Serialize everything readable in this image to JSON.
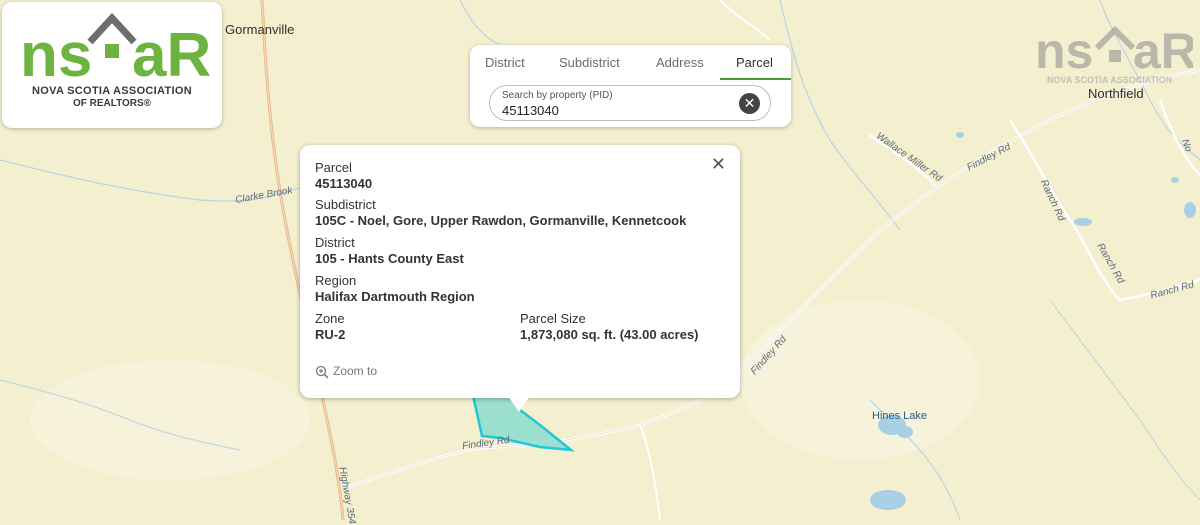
{
  "logo": {
    "brand": "nsaR",
    "line1": "NOVA SCOTIA ASSOCIATION",
    "line2": "OF REALTORS®"
  },
  "watermark": {
    "brand": "nsaR",
    "line1": "NOVA SCOTIA ASSOCIATION"
  },
  "search": {
    "tabs": [
      {
        "label": "District"
      },
      {
        "label": "Subdistrict"
      },
      {
        "label": "Address"
      },
      {
        "label": "Parcel"
      }
    ],
    "active_tab": "Parcel",
    "placeholder": "Search by property (PID)",
    "value": "45113040"
  },
  "popup": {
    "parcel_label": "Parcel",
    "parcel_value": "45113040",
    "subdistrict_label": "Subdistrict",
    "subdistrict_value": "105C - Noel, Gore, Upper Rawdon, Gormanville, Kennetcook",
    "district_label": "District",
    "district_value": "105 - Hants County East",
    "region_label": "Region",
    "region_value": "Halifax Dartmouth Region",
    "zone_label": "Zone",
    "zone_value": "RU-2",
    "size_label": "Parcel Size",
    "size_value": "1,873,080 sq. ft. (43.00 acres)",
    "zoom_label": "Zoom to"
  },
  "map": {
    "towns": {
      "gormanville": "Gormanville",
      "northfield": "Northfield"
    },
    "features": {
      "clarke_brook": "Clarke Brook",
      "wallace_miller_rd": "Wallace Miller Rd",
      "findley_rd_1": "Findley Rd",
      "findley_rd_2": "Findley Rd",
      "findley_rd_3": "Findley Rd",
      "ranch_rd_1": "Ranch Rd",
      "ranch_rd_2": "Ranch Rd",
      "ranch_rd_3": "Ranch Rd",
      "highway": "Highway 354",
      "hines_lake": "Hines Lake",
      "corner_rd": "No"
    }
  },
  "colors": {
    "land": "#f3efcf",
    "water": "#a9cfe6",
    "road": "#ffffff",
    "highway": "#e8b58a",
    "brand_green": "#6db33f",
    "parcel_fill": "#7ed9cf",
    "parcel_stroke": "#23c6d6"
  }
}
